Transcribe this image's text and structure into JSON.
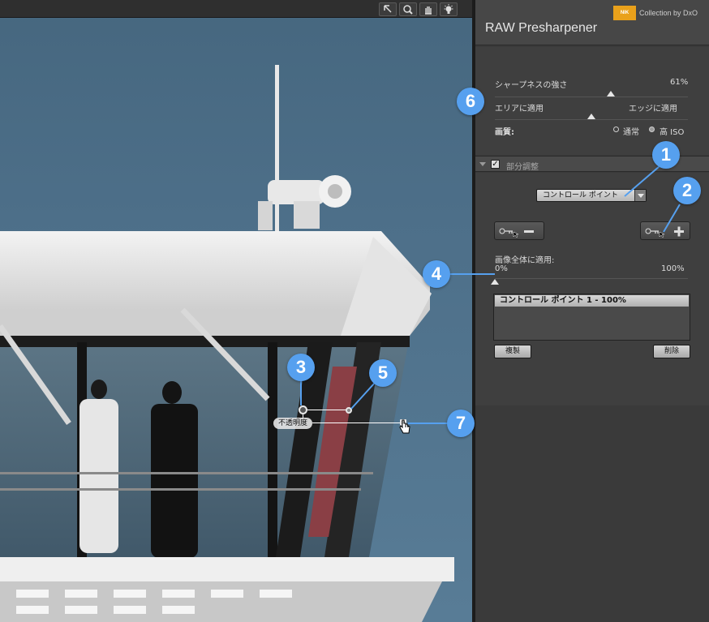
{
  "toolbar": {
    "tools": [
      {
        "icon": "arrow-pointer-icon"
      },
      {
        "icon": "zoom-icon"
      },
      {
        "icon": "hand-pan-icon"
      },
      {
        "icon": "bulb-icon"
      }
    ]
  },
  "brand": {
    "logo_text": "NIK",
    "collection": "Collection by DxO",
    "accent_color": "#e9a11b"
  },
  "panel": {
    "title": "RAW Presharpener",
    "sharpness_label": "シャープネスの強さ",
    "sharpness_value": "61%",
    "sharpness_fraction": 0.61,
    "area_label": "エリアに適用",
    "edge_label": "エッジに適用",
    "area_edge_fraction": 0.5,
    "quality_label": "画質:",
    "quality_options": [
      "通常",
      "高 ISO"
    ],
    "quality_selected": "高 ISO",
    "section_title": "部分調整",
    "section_checked": true,
    "mode_select": "コントロール ポイント",
    "apply_all_label": "画像全体に適用:",
    "apply_all_min": "0%",
    "apply_all_max": "100%",
    "apply_all_fraction": 0.0,
    "control_points": [
      "コントロール ポイント 1 - 100%"
    ],
    "duplicate_label": "複製",
    "delete_label": "削除"
  },
  "overlay": {
    "opacity_label": "不透明度"
  },
  "callouts": [
    "1",
    "2",
    "3",
    "4",
    "5",
    "6",
    "7"
  ],
  "colors": {
    "callout": "#56a0ef",
    "panel_bg": "#3a3a3a",
    "sky": "#4d6f89"
  }
}
